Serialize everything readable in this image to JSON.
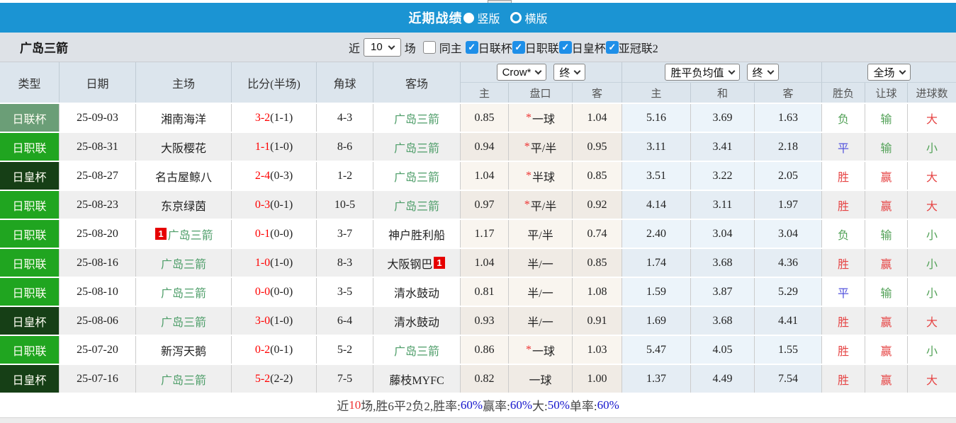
{
  "colors": {
    "topbar_blue": "#1b94d3",
    "league_cup_green": "#6b9e77",
    "j_league_green": "#20a520",
    "emperor_cup_green": "#163f16",
    "team_highlight_green": "#4d9d68",
    "score_red": "#ff0000",
    "win_red": "#e64545",
    "lose_green": "#53a258",
    "draw_blue": "#5353dd",
    "rate_blue": "#1414cc",
    "checkbox_blue": "#1e8fe8"
  },
  "icons": {
    "check": "✓",
    "star": "*",
    "badge_one": "1"
  },
  "topbar": {
    "title": "近期战绩",
    "radio_vertical_label": "竖版",
    "radio_horizontal_label": "横版"
  },
  "filterbar": {
    "team": "广岛三箭",
    "near_label": "近",
    "near_value": "10",
    "matches_label": "场",
    "same_home_label": "同主",
    "league_filters": [
      "日联杯",
      "日职联",
      "日皇杯",
      "亚冠联2"
    ]
  },
  "table": {
    "left_headers": [
      "类型",
      "日期",
      "主场",
      "比分(半场)",
      "角球",
      "客场"
    ],
    "selects": {
      "company": "Crow*",
      "final1": "终",
      "avg": "胜平负均值",
      "final2": "终",
      "scope": "全场"
    },
    "sub_headers": {
      "odds": [
        "主",
        "盘口",
        "客"
      ],
      "avg": [
        "主",
        "和",
        "客"
      ],
      "results": [
        "胜负",
        "让球",
        "进球数"
      ]
    },
    "rows": [
      {
        "type": "日联杯",
        "type_style": "league-cup",
        "date": "25-09-03",
        "home": {
          "name": "湘南海洋",
          "highlight": false
        },
        "score_full": "3-2",
        "score_half": "(1-1)",
        "corner": "4-3",
        "away": {
          "name": "广岛三箭",
          "highlight": true
        },
        "odds_home": "0.85",
        "handicap_star": true,
        "handicap": "一球",
        "odds_away": "1.04",
        "avg_home": "5.16",
        "avg_draw": "3.69",
        "avg_away": "1.63",
        "res_wdl": {
          "text": "负",
          "c": "green"
        },
        "res_let": {
          "text": "输",
          "c": "green"
        },
        "res_goal": {
          "text": "大",
          "c": "red"
        }
      },
      {
        "type": "日职联",
        "type_style": "j-league",
        "date": "25-08-31",
        "home": {
          "name": "大阪樱花",
          "highlight": false
        },
        "score_full": "1-1",
        "score_half": "(1-0)",
        "corner": "8-6",
        "away": {
          "name": "广岛三箭",
          "highlight": true
        },
        "odds_home": "0.94",
        "handicap_star": true,
        "handicap": "平/半",
        "odds_away": "0.95",
        "avg_home": "3.11",
        "avg_draw": "3.41",
        "avg_away": "2.18",
        "res_wdl": {
          "text": "平",
          "c": "blue"
        },
        "res_let": {
          "text": "输",
          "c": "green"
        },
        "res_goal": {
          "text": "小",
          "c": "green"
        }
      },
      {
        "type": "日皇杯",
        "type_style": "emperor-cup",
        "date": "25-08-27",
        "home": {
          "name": "名古屋鲸八",
          "highlight": false
        },
        "score_full": "2-4",
        "score_half": "(0-3)",
        "corner": "1-2",
        "away": {
          "name": "广岛三箭",
          "highlight": true
        },
        "odds_home": "1.04",
        "handicap_star": true,
        "handicap": "半球",
        "odds_away": "0.85",
        "avg_home": "3.51",
        "avg_draw": "3.22",
        "avg_away": "2.05",
        "res_wdl": {
          "text": "胜",
          "c": "red"
        },
        "res_let": {
          "text": "赢",
          "c": "red"
        },
        "res_goal": {
          "text": "大",
          "c": "red"
        }
      },
      {
        "type": "日职联",
        "type_style": "j-league",
        "date": "25-08-23",
        "home": {
          "name": "东京绿茵",
          "highlight": false
        },
        "score_full": "0-3",
        "score_half": "(0-1)",
        "corner": "10-5",
        "away": {
          "name": "广岛三箭",
          "highlight": true
        },
        "odds_home": "0.97",
        "handicap_star": true,
        "handicap": "平/半",
        "odds_away": "0.92",
        "avg_home": "4.14",
        "avg_draw": "3.11",
        "avg_away": "1.97",
        "res_wdl": {
          "text": "胜",
          "c": "red"
        },
        "res_let": {
          "text": "赢",
          "c": "red"
        },
        "res_goal": {
          "text": "大",
          "c": "red"
        }
      },
      {
        "type": "日职联",
        "type_style": "j-league",
        "date": "25-08-20",
        "home": {
          "name": "广岛三箭",
          "highlight": true,
          "badge": "1",
          "badge_pos": "before"
        },
        "score_full": "0-1",
        "score_half": "(0-0)",
        "corner": "3-7",
        "away": {
          "name": "神户胜利船",
          "highlight": false
        },
        "odds_home": "1.17",
        "handicap_star": false,
        "handicap": "平/半",
        "odds_away": "0.74",
        "avg_home": "2.40",
        "avg_draw": "3.04",
        "avg_away": "3.04",
        "res_wdl": {
          "text": "负",
          "c": "green"
        },
        "res_let": {
          "text": "输",
          "c": "green"
        },
        "res_goal": {
          "text": "小",
          "c": "green"
        }
      },
      {
        "type": "日职联",
        "type_style": "j-league",
        "date": "25-08-16",
        "home": {
          "name": "广岛三箭",
          "highlight": true
        },
        "score_full": "1-0",
        "score_half": "(1-0)",
        "corner": "8-3",
        "away": {
          "name": "大阪钢巴",
          "highlight": false,
          "badge": "1",
          "badge_pos": "after"
        },
        "odds_home": "1.04",
        "handicap_star": false,
        "handicap": "半/一",
        "odds_away": "0.85",
        "avg_home": "1.74",
        "avg_draw": "3.68",
        "avg_away": "4.36",
        "res_wdl": {
          "text": "胜",
          "c": "red"
        },
        "res_let": {
          "text": "赢",
          "c": "red"
        },
        "res_goal": {
          "text": "小",
          "c": "green"
        }
      },
      {
        "type": "日职联",
        "type_style": "j-league",
        "date": "25-08-10",
        "home": {
          "name": "广岛三箭",
          "highlight": true
        },
        "score_full": "0-0",
        "score_half": "(0-0)",
        "corner": "3-5",
        "away": {
          "name": "清水鼓动",
          "highlight": false
        },
        "odds_home": "0.81",
        "handicap_star": false,
        "handicap": "半/一",
        "odds_away": "1.08",
        "avg_home": "1.59",
        "avg_draw": "3.87",
        "avg_away": "5.29",
        "res_wdl": {
          "text": "平",
          "c": "blue"
        },
        "res_let": {
          "text": "输",
          "c": "green"
        },
        "res_goal": {
          "text": "小",
          "c": "green"
        }
      },
      {
        "type": "日皇杯",
        "type_style": "emperor-cup",
        "date": "25-08-06",
        "home": {
          "name": "广岛三箭",
          "highlight": true
        },
        "score_full": "3-0",
        "score_half": "(1-0)",
        "corner": "6-4",
        "away": {
          "name": "清水鼓动",
          "highlight": false
        },
        "odds_home": "0.93",
        "handicap_star": false,
        "handicap": "半/一",
        "odds_away": "0.91",
        "avg_home": "1.69",
        "avg_draw": "3.68",
        "avg_away": "4.41",
        "res_wdl": {
          "text": "胜",
          "c": "red"
        },
        "res_let": {
          "text": "赢",
          "c": "red"
        },
        "res_goal": {
          "text": "大",
          "c": "red"
        }
      },
      {
        "type": "日职联",
        "type_style": "j-league",
        "date": "25-07-20",
        "home": {
          "name": "新泻天鹅",
          "highlight": false
        },
        "score_full": "0-2",
        "score_half": "(0-1)",
        "corner": "5-2",
        "away": {
          "name": "广岛三箭",
          "highlight": true
        },
        "odds_home": "0.86",
        "handicap_star": true,
        "handicap": "一球",
        "odds_away": "1.03",
        "avg_home": "5.47",
        "avg_draw": "4.05",
        "avg_away": "1.55",
        "res_wdl": {
          "text": "胜",
          "c": "red"
        },
        "res_let": {
          "text": "赢",
          "c": "red"
        },
        "res_goal": {
          "text": "小",
          "c": "green"
        }
      },
      {
        "type": "日皇杯",
        "type_style": "emperor-cup",
        "date": "25-07-16",
        "home": {
          "name": "广岛三箭",
          "highlight": true
        },
        "score_full": "5-2",
        "score_half": "(2-2)",
        "corner": "7-5",
        "away": {
          "name": "藤枝MYFC",
          "highlight": false
        },
        "odds_home": "0.82",
        "handicap_star": false,
        "handicap": "一球",
        "odds_away": "1.00",
        "avg_home": "1.37",
        "avg_draw": "4.49",
        "avg_away": "7.54",
        "res_wdl": {
          "text": "胜",
          "c": "red"
        },
        "res_let": {
          "text": "赢",
          "c": "red"
        },
        "res_goal": {
          "text": "大",
          "c": "red"
        }
      }
    ]
  },
  "summary": {
    "segments": [
      {
        "text": "近",
        "c": "dark"
      },
      {
        "text": "10",
        "c": "red"
      },
      {
        "text": "场,胜6平2负2, ",
        "c": "dark"
      },
      {
        "text": "胜率:",
        "c": "dark"
      },
      {
        "text": "60%",
        "c": "blue"
      },
      {
        "text": " 赢率:",
        "c": "dark"
      },
      {
        "text": "60%",
        "c": "blue"
      },
      {
        "text": " 大:",
        "c": "dark"
      },
      {
        "text": "50%",
        "c": "blue"
      },
      {
        "text": " 单率:",
        "c": "dark"
      },
      {
        "text": "60%",
        "c": "blue"
      }
    ]
  }
}
